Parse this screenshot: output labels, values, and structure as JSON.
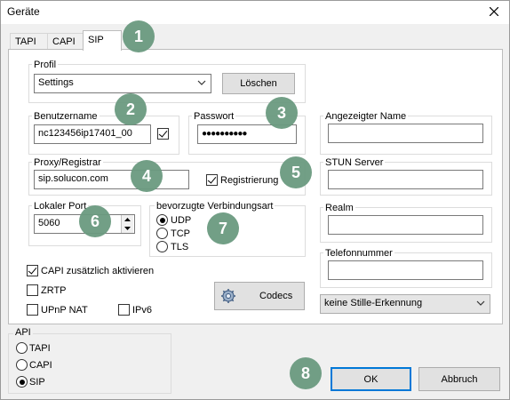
{
  "window": {
    "title": "Geräte"
  },
  "tabs": [
    {
      "label": "TAPI"
    },
    {
      "label": "CAPI"
    },
    {
      "label": "SIP"
    }
  ],
  "profile": {
    "group_label": "Profil",
    "selected": "Settings",
    "delete_label": "Löschen"
  },
  "username": {
    "label": "Benutzername",
    "value": "nc123456ip17401_00"
  },
  "password": {
    "label": "Passwort",
    "value": "●●●●●●●●●●"
  },
  "display_name": {
    "label": "Angezeigter Name",
    "value": ""
  },
  "proxy": {
    "label": "Proxy/Registrar",
    "value": "sip.solucon.com",
    "registration_label": "Registrierung"
  },
  "stun": {
    "label": "STUN Server",
    "value": ""
  },
  "local_port": {
    "label": "Lokaler Port",
    "value": "5060"
  },
  "transport": {
    "label": "bevorzugte Verbindungsart",
    "options": [
      "UDP",
      "TCP",
      "TLS"
    ],
    "selected": "UDP"
  },
  "realm": {
    "label": "Realm",
    "value": ""
  },
  "phone": {
    "label": "Telefonnummer",
    "value": ""
  },
  "options": {
    "capi_extra": "CAPI zusätzlich aktivieren",
    "zrtp": "ZRTP",
    "upnp": "UPnP NAT",
    "ipv6": "IPv6"
  },
  "codecs_label": "Codecs",
  "silence": {
    "selected": "keine Stille-Erkennung"
  },
  "api": {
    "group_label": "API",
    "options": [
      "TAPI",
      "CAPI",
      "SIP"
    ],
    "selected": "SIP"
  },
  "buttons": {
    "ok": "OK",
    "cancel": "Abbruch"
  },
  "badges": [
    "1",
    "2",
    "3",
    "4",
    "5",
    "6",
    "7",
    "8"
  ],
  "colors": {
    "badge": "#6b9a80",
    "accent": "#0078d7"
  }
}
